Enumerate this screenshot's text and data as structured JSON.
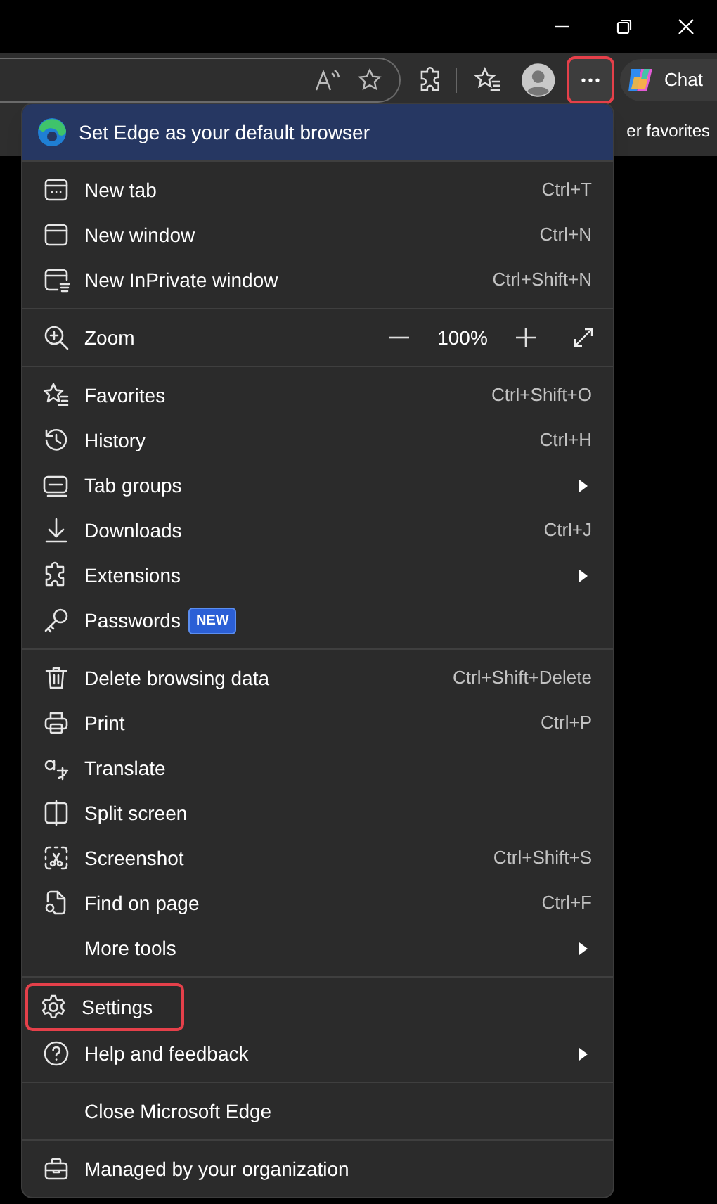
{
  "toolbar": {
    "more_button_highlighted": true,
    "chat_button": "Chat"
  },
  "favorites_bar": {
    "item": "er favorites"
  },
  "menu": {
    "banner": "Set Edge as your default browser",
    "sections": [
      [
        {
          "kind": "item",
          "label": "New tab",
          "shortcut": "Ctrl+T",
          "highlighted": false
        },
        {
          "kind": "item",
          "label": "New window",
          "shortcut": "Ctrl+N",
          "highlighted": false
        },
        {
          "kind": "item",
          "label": "New InPrivate window",
          "shortcut": "Ctrl+Shift+N",
          "highlighted": false
        }
      ],
      [
        {
          "kind": "zoom",
          "label": "Zoom",
          "value": "100%",
          "highlighted": false
        }
      ],
      [
        {
          "kind": "item",
          "label": "Favorites",
          "shortcut": "Ctrl+Shift+O",
          "highlighted": false
        },
        {
          "kind": "item",
          "label": "History",
          "shortcut": "Ctrl+H",
          "highlighted": false
        },
        {
          "kind": "item",
          "label": "Tab groups",
          "submenu": true,
          "highlighted": false
        },
        {
          "kind": "item",
          "label": "Downloads",
          "shortcut": "Ctrl+J",
          "highlighted": false
        },
        {
          "kind": "item",
          "label": "Extensions",
          "submenu": true,
          "highlighted": false
        },
        {
          "kind": "item",
          "label": "Passwords",
          "badge": "NEW",
          "highlighted": false
        }
      ],
      [
        {
          "kind": "item",
          "label": "Delete browsing data",
          "shortcut": "Ctrl+Shift+Delete",
          "highlighted": false
        },
        {
          "kind": "item",
          "label": "Print",
          "shortcut": "Ctrl+P",
          "highlighted": false
        },
        {
          "kind": "item",
          "label": "Translate",
          "highlighted": false
        },
        {
          "kind": "item",
          "label": "Split screen",
          "highlighted": false
        },
        {
          "kind": "item",
          "label": "Screenshot",
          "shortcut": "Ctrl+Shift+S",
          "highlighted": false
        },
        {
          "kind": "item",
          "label": "Find on page",
          "shortcut": "Ctrl+F",
          "highlighted": false
        },
        {
          "kind": "item",
          "label": "More tools",
          "submenu": true,
          "highlighted": false
        }
      ],
      [
        {
          "kind": "item",
          "label": "Settings",
          "highlighted": true
        },
        {
          "kind": "item",
          "label": "Help and feedback",
          "submenu": true,
          "highlighted": false
        }
      ],
      [
        {
          "kind": "item",
          "label": "Close Microsoft Edge",
          "highlighted": false
        }
      ],
      [
        {
          "kind": "item",
          "label": "Managed by your organization",
          "highlighted": false
        }
      ]
    ]
  }
}
